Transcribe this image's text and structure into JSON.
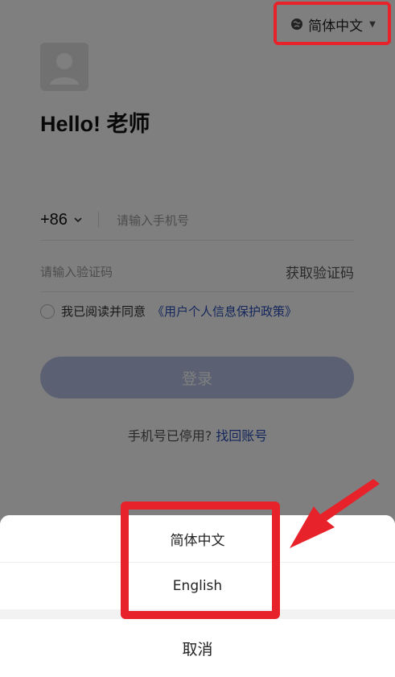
{
  "header": {
    "language_switch_label": "简体中文",
    "icons": {
      "language": "globe-icon",
      "caret": "triangle-down-icon"
    }
  },
  "login": {
    "avatar_icon": "user-avatar-icon",
    "greeting": "Hello! 老师",
    "country_code": "+86",
    "phone_placeholder": "请输入手机号",
    "code_placeholder": "请输入验证码",
    "get_code_label": "获取验证码",
    "agree_prefix": "我已阅读并同意",
    "policy_link": "《用户个人信息保护政策》",
    "login_button": "登录",
    "recover_prefix": "手机号已停用?",
    "recover_link": "找回账号"
  },
  "sheet": {
    "options": [
      "简体中文",
      "English"
    ],
    "cancel_label": "取消"
  },
  "colors": {
    "highlight": "#e7222a",
    "link": "#2a4fb8",
    "login_button_bg": "#b7c3e6"
  }
}
